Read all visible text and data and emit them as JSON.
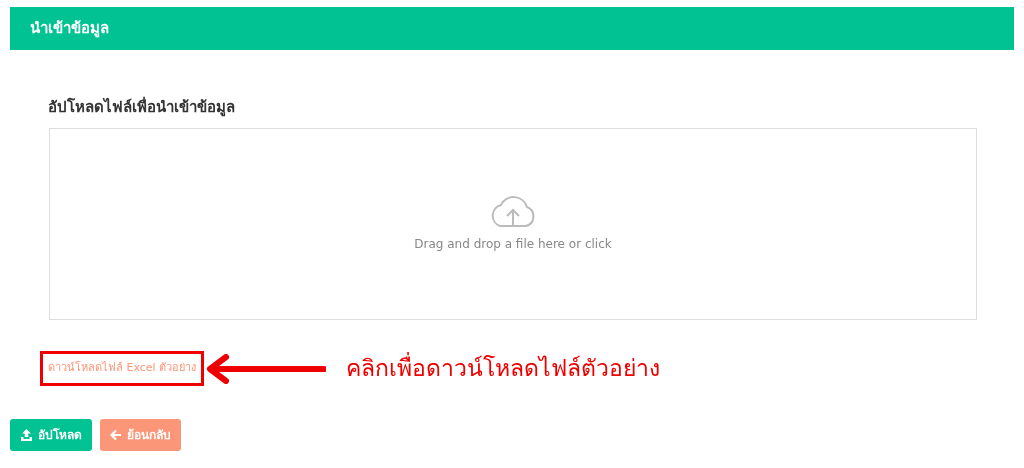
{
  "header": {
    "title": "นำเข้าข้อมูล"
  },
  "upload": {
    "label": "อัปโหลดไฟล์เพื่อนำเข้าข้อมูล",
    "dropzone_text": "Drag and drop a file here or click"
  },
  "sample_link": {
    "text": "ดาวน์โหลดไฟล์ Excel ตัวอย่าง",
    "highlighted": true
  },
  "annotation": {
    "text": "คลิกเพื่อดาวน์โหลดไฟล์ตัวอย่าง"
  },
  "buttons": [
    {
      "kind": "upload",
      "label": "อัปโหลด"
    },
    {
      "kind": "back",
      "label": "ย้อนกลับ"
    }
  ]
}
